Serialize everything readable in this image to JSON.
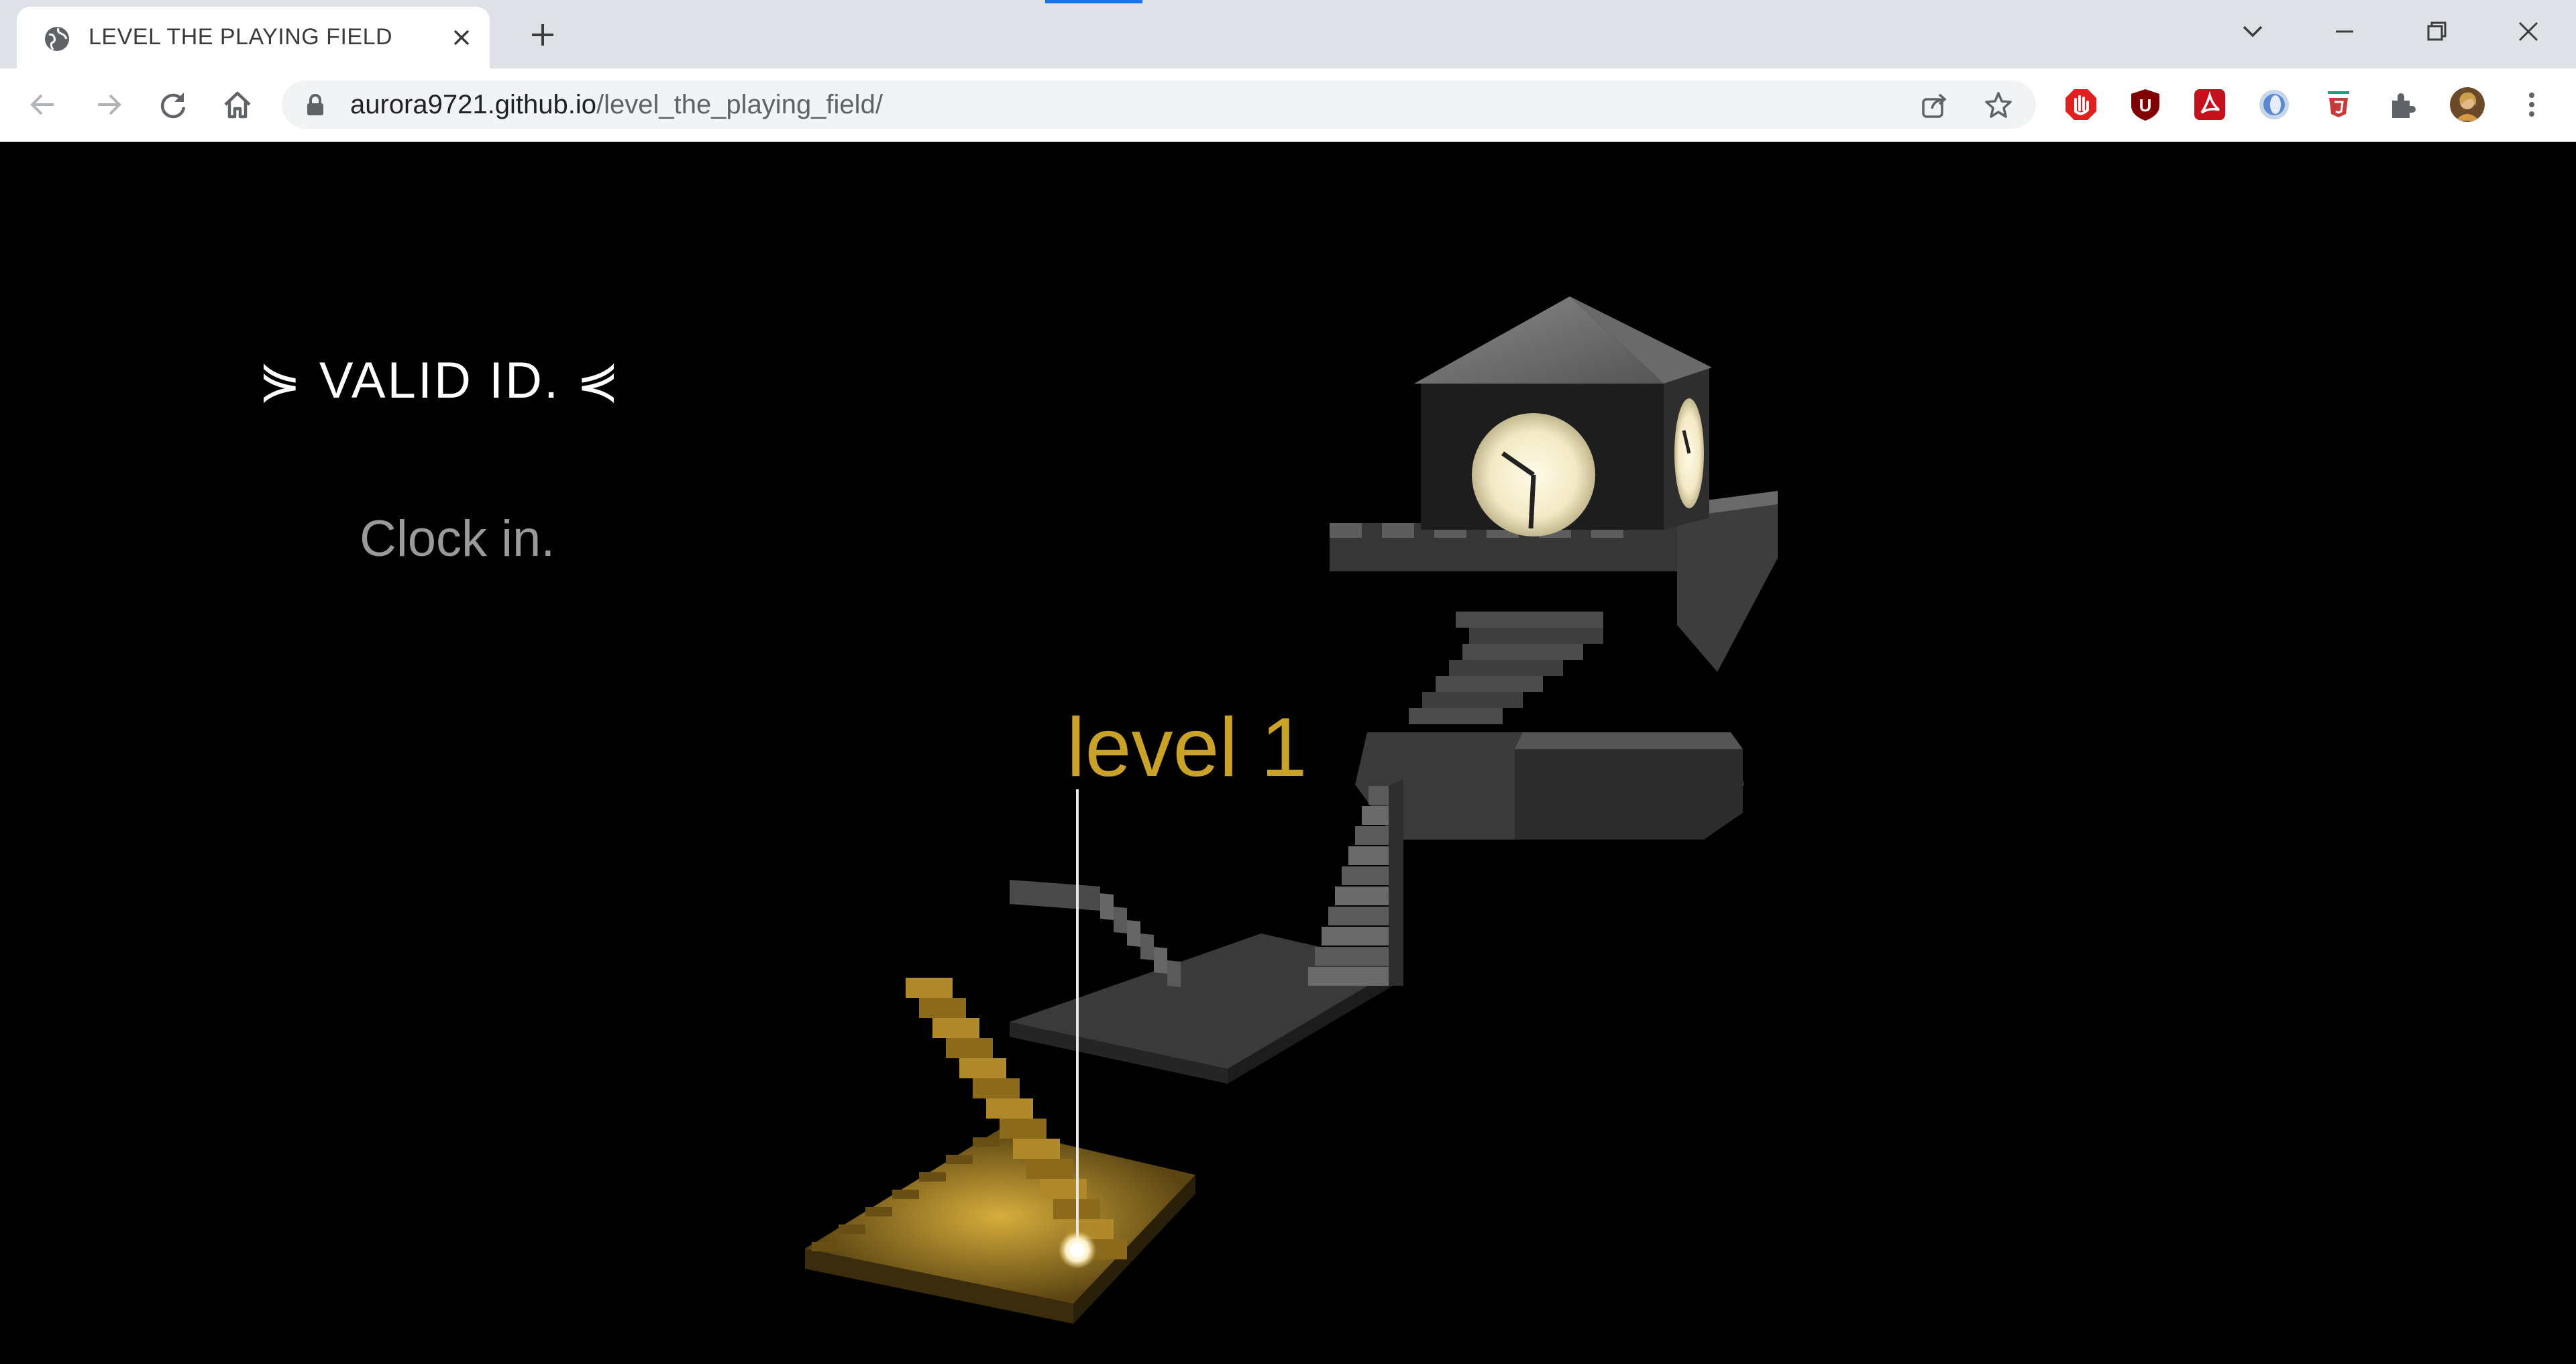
{
  "browser": {
    "tab_title": "LEVEL THE PLAYING FIELD",
    "url_host": "aurora9721.github.io",
    "url_path": "/level_the_playing_field/"
  },
  "page": {
    "heading": "VALID ID.",
    "heading_left_glyph": "⋟",
    "heading_right_glyph": "⋞",
    "subtitle": "Clock in.",
    "level_label": "level 1"
  },
  "colors": {
    "accent_gold": "#c9a227",
    "page_background": "#000000"
  },
  "icons": [
    "globe-icon",
    "close-icon",
    "plus-icon",
    "chevron-down-icon",
    "minimize-icon",
    "restore-icon",
    "window-close-icon",
    "back-icon",
    "forward-icon",
    "reload-icon",
    "home-icon",
    "lock-icon",
    "share-icon",
    "star-icon",
    "extensions-icon",
    "menu-icon"
  ]
}
